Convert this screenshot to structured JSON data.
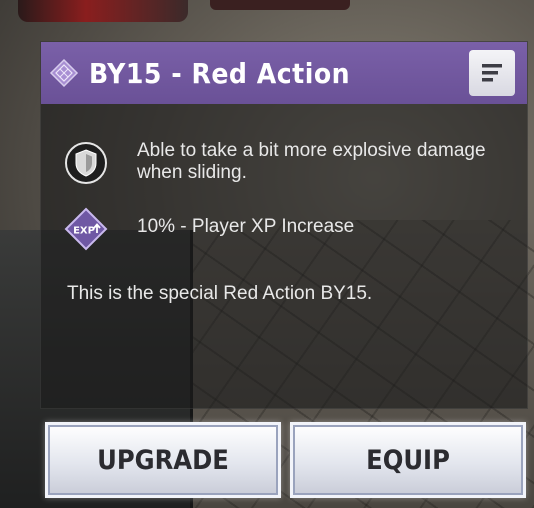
{
  "item": {
    "title": "BY15 - Red Action",
    "rarity_color": "#7a60a8",
    "rarity_icon": "epic-diamond-icon"
  },
  "perks": [
    {
      "icon": "armor-shield-icon",
      "text": "Able to take a bit more explosive damage when sliding."
    },
    {
      "icon": "exp-boost-icon",
      "icon_text": "EXP",
      "text": "10% - Player XP Increase"
    }
  ],
  "description": "This is the special Red Action BY15.",
  "buttons": {
    "upgrade_label": "UPGRADE",
    "equip_label": "EQUIP"
  },
  "menu_icon": "details-menu-icon"
}
